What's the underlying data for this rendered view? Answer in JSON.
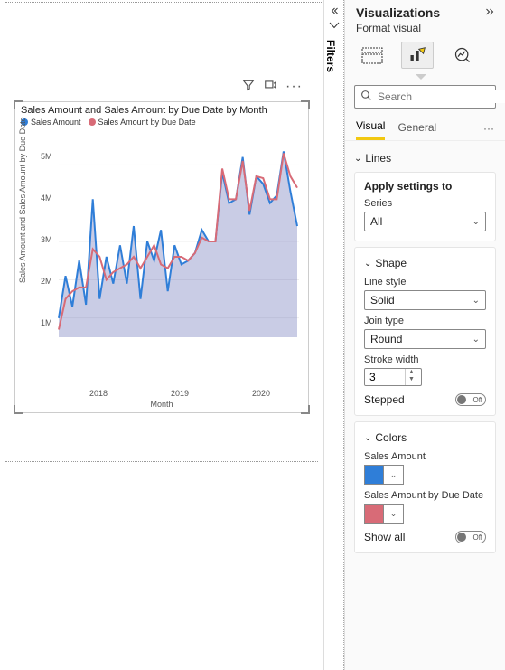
{
  "filters_label": "Filters",
  "chart": {
    "title": "Sales Amount and Sales Amount by Due Date by Month",
    "legend": [
      {
        "label": "Sales Amount",
        "color": "#2f7ed8"
      },
      {
        "label": "Sales Amount by Due Date",
        "color": "#d86b77"
      }
    ],
    "ylabel": "Sales Amount and Sales Amount by Due Date",
    "xlabel": "Month",
    "yticks": [
      "1M",
      "2M",
      "3M",
      "4M",
      "5M"
    ],
    "xticks": [
      "2018",
      "2019",
      "2020"
    ]
  },
  "chart_data": {
    "type": "line",
    "xlabel": "Month",
    "ylabel": "Sales Amount and Sales Amount by Due Date",
    "ylim": [
      500000,
      5500000
    ],
    "x": [
      "2017-07",
      "2017-08",
      "2017-09",
      "2017-10",
      "2017-11",
      "2017-12",
      "2018-01",
      "2018-02",
      "2018-03",
      "2018-04",
      "2018-05",
      "2018-06",
      "2018-07",
      "2018-08",
      "2018-09",
      "2018-10",
      "2018-11",
      "2018-12",
      "2019-01",
      "2019-02",
      "2019-03",
      "2019-04",
      "2019-05",
      "2019-06",
      "2019-07",
      "2019-08",
      "2019-09",
      "2019-10",
      "2019-11",
      "2019-12",
      "2020-01",
      "2020-02",
      "2020-03",
      "2020-04",
      "2020-05",
      "2020-06"
    ],
    "series": [
      {
        "name": "Sales Amount",
        "color": "#2f7ed8",
        "values": [
          1000000,
          2100000,
          1300000,
          2500000,
          1350000,
          4100000,
          1500000,
          2600000,
          1900000,
          2900000,
          1900000,
          3400000,
          1500000,
          3000000,
          2500000,
          3300000,
          1700000,
          2900000,
          2400000,
          2500000,
          2700000,
          3300000,
          3000000,
          3000000,
          4800000,
          4000000,
          4100000,
          5200000,
          3700000,
          4700000,
          4500000,
          4000000,
          4200000,
          5350000,
          4300000,
          3400000
        ]
      },
      {
        "name": "Sales Amount by Due Date",
        "color": "#d86b77",
        "values": [
          700000,
          1500000,
          1700000,
          1800000,
          1800000,
          2800000,
          2600000,
          2000000,
          2200000,
          2300000,
          2400000,
          2600000,
          2300000,
          2600000,
          2900000,
          2400000,
          2300000,
          2600000,
          2600000,
          2500000,
          2700000,
          3100000,
          3000000,
          3000000,
          4900000,
          4100000,
          4100000,
          5100000,
          3800000,
          4700000,
          4650000,
          4100000,
          4100000,
          5300000,
          4700000,
          4400000
        ]
      }
    ],
    "xtick_labels": [
      "2018",
      "2019",
      "2020"
    ]
  },
  "pane": {
    "title": "Visualizations",
    "subtitle": "Format visual",
    "search_placeholder": "Search",
    "tabs": {
      "visual": "Visual",
      "general": "General"
    },
    "sections": {
      "lines": "Lines",
      "apply": "Apply settings to",
      "series_label": "Series",
      "series_value": "All",
      "shape": "Shape",
      "line_style_label": "Line style",
      "line_style_value": "Solid",
      "join_type_label": "Join type",
      "join_type_value": "Round",
      "stroke_width_label": "Stroke width",
      "stroke_width_value": "3",
      "stepped_label": "Stepped",
      "colors": "Colors",
      "series1_label": "Sales Amount",
      "series1_color": "#2f7ed8",
      "series2_label": "Sales Amount by Due Date",
      "series2_color": "#d86b77",
      "show_all_label": "Show all",
      "toggle_off": "Off"
    }
  }
}
